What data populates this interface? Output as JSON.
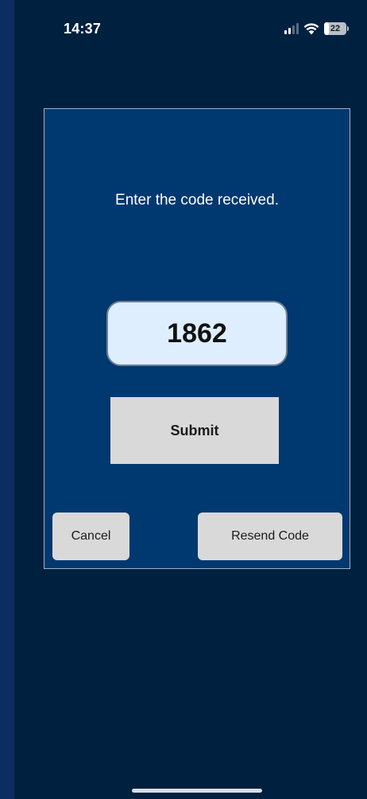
{
  "status_bar": {
    "time": "14:37",
    "battery_percent": "22",
    "battery_level": 0.22,
    "signal_bars_active": 2,
    "signal_bars_total": 4,
    "icons": [
      "signal-icon",
      "wifi-icon",
      "battery-icon"
    ]
  },
  "dialog": {
    "prompt": "Enter the code received.",
    "code_value": "1862",
    "submit_label": "Submit",
    "cancel_label": "Cancel",
    "resend_label": "Resend Code"
  },
  "colors": {
    "background": "#00203f",
    "dialog_background": "#003870",
    "code_field_background": "#deeeff",
    "button_background": "#d9d9d9"
  }
}
